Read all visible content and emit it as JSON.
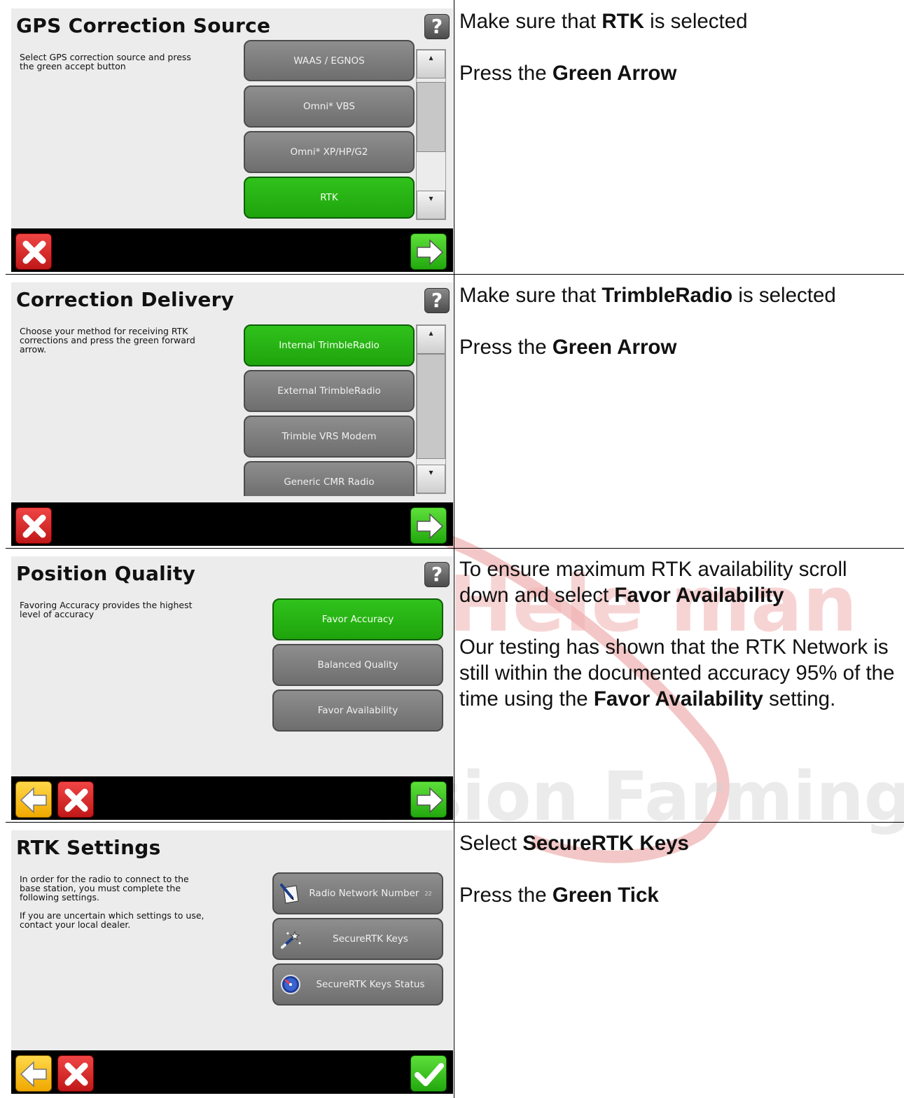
{
  "watermark": {
    "text_top": "Hele man",
    "text_bottom": "Precision Farming"
  },
  "colors": {
    "selected_green": "#22b410",
    "option_gray": "#7a7a7a",
    "cancel_red": "#d52525",
    "back_yellow": "#f6bd14",
    "bar_black": "#000000"
  },
  "rows": [
    {
      "screen": {
        "title": "GPS Correction Source",
        "help_icon": "?",
        "description": "Select GPS correction source and press\nthe green accept button",
        "options": [
          {
            "label": "WAAS / EGNOS",
            "selected": false
          },
          {
            "label": "Omni* VBS",
            "selected": false
          },
          {
            "label": "Omni* XP/HP/G2",
            "selected": false
          },
          {
            "label": "RTK",
            "selected": true
          }
        ],
        "scroll_up": "▴",
        "scroll_down": "▾"
      },
      "instructions": {
        "p1_pre": "Make sure that ",
        "p1_bold": "RTK",
        "p1_post": " is selected",
        "p2_pre": "Press the ",
        "p2_bold": "Green Arrow"
      }
    },
    {
      "screen": {
        "title": "Correction Delivery",
        "help_icon": "?",
        "description": "Choose your method for receiving RTK\ncorrections and press the green forward\narrow.",
        "options": [
          {
            "label": "Internal TrimbleRadio",
            "selected": true
          },
          {
            "label": "External TrimbleRadio",
            "selected": false
          },
          {
            "label": "Trimble VRS Modem",
            "selected": false
          },
          {
            "label": "Generic CMR Radio",
            "selected": false
          }
        ],
        "scroll_up": "▴",
        "scroll_down": "▾"
      },
      "instructions": {
        "p1_pre": "Make sure that ",
        "p1_bold": "TrimbleRadio",
        "p1_post": " is selected",
        "p2_pre": "Press the ",
        "p2_bold": "Green Arrow"
      }
    },
    {
      "screen": {
        "title": "Position Quality",
        "help_icon": "?",
        "description": "Favoring Accuracy provides the highest\nlevel of accuracy",
        "options": [
          {
            "label": "Favor Accuracy",
            "selected": true
          },
          {
            "label": "Balanced Quality",
            "selected": false
          },
          {
            "label": "Favor Availability",
            "selected": false
          }
        ]
      },
      "instructions": {
        "p1_pre": "To ensure maximum RTK availability scroll down and select ",
        "p1_bold": "Favor Availability",
        "p2_pre": "Our testing has shown that the RTK Network is still within the documented accuracy 95% of the time using the ",
        "p2_bold": "Favor Availability",
        "p2_post": " setting."
      }
    },
    {
      "screen": {
        "title": "RTK Settings",
        "description": "In order for the radio to connect to the\nbase station, you must complete the\nfollowing settings.\n\nIf you are uncertain which settings to use,\n contact your local dealer.",
        "options": [
          {
            "label": "Radio Network Number",
            "badge": "22",
            "icon": "notepad-icon"
          },
          {
            "label": "SecureRTK Keys",
            "icon": "magic-wand-icon"
          },
          {
            "label": "SecureRTK Keys Status",
            "icon": "gauge-icon"
          }
        ]
      },
      "instructions": {
        "p1_pre": "Select ",
        "p1_bold": "SecureRTK Keys",
        "p2_pre": "Press the ",
        "p2_bold": "Green Tick"
      }
    }
  ]
}
